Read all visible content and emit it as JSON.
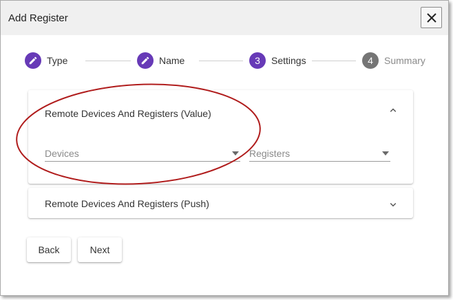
{
  "dialog": {
    "title": "Add Register",
    "close_icon": "close-icon"
  },
  "stepper": {
    "active_color": "#673ab7",
    "inactive_color": "#757575",
    "steps": [
      {
        "indicator": "edit-icon",
        "label": "Type",
        "state": "completed"
      },
      {
        "indicator": "edit-icon",
        "label": "Name",
        "state": "completed"
      },
      {
        "indicator": "3",
        "label": "Settings",
        "state": "active"
      },
      {
        "indicator": "4",
        "label": "Summary",
        "state": "inactive"
      }
    ]
  },
  "panels": [
    {
      "title": "Remote Devices And Registers (Value)",
      "expanded": true,
      "chevron_icon": "chevron-up-icon",
      "fields": [
        {
          "placeholder": "Devices",
          "dropdown_icon": "dropdown-arrow-icon"
        },
        {
          "placeholder": "Registers",
          "dropdown_icon": "dropdown-arrow-icon"
        }
      ]
    },
    {
      "title": "Remote Devices And Registers (Push)",
      "expanded": false,
      "chevron_icon": "chevron-down-icon"
    }
  ],
  "actions": {
    "back_label": "Back",
    "next_label": "Next"
  },
  "annotation": {
    "shape": "ellipse",
    "color": "#b01c1c"
  }
}
